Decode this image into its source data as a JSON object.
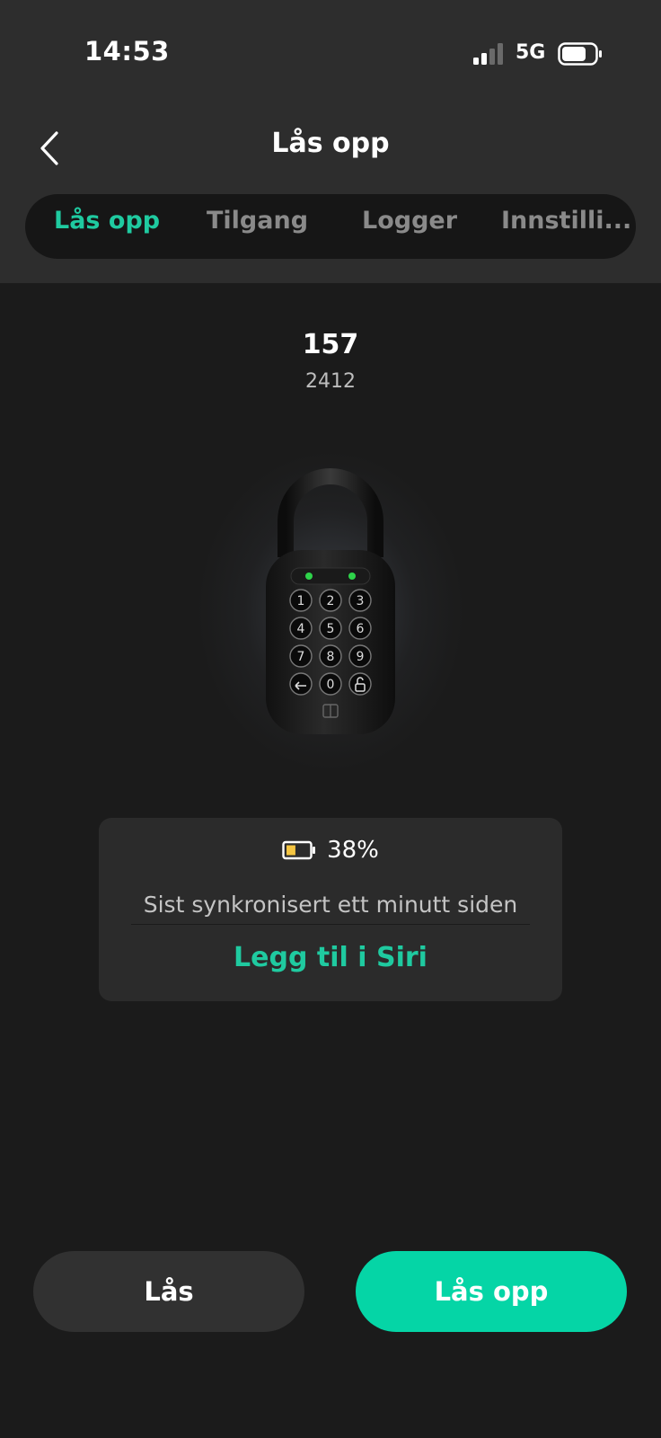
{
  "status_bar": {
    "time": "14:53",
    "network": "5G",
    "icons": [
      "signal-bars-icon",
      "battery-icon"
    ]
  },
  "nav": {
    "back_icon": "chevron-left-icon",
    "title": "Lås opp"
  },
  "tabs": [
    {
      "label": "Lås opp",
      "active": true
    },
    {
      "label": "Tilgang",
      "active": false
    },
    {
      "label": "Logger",
      "active": false
    },
    {
      "label": "Innstilli...",
      "active": false
    }
  ],
  "lock": {
    "name": "157",
    "code": "2412",
    "image_icon": "padlock-keypad-icon"
  },
  "info_card": {
    "battery_percent": "38%",
    "battery_level": 0.38,
    "battery_icon": "battery-low-icon",
    "sync_text": "Sist synkronisert ett minutt siden",
    "siri_link": "Legg til i Siri"
  },
  "actions": {
    "lock_label": "Lås",
    "unlock_label": "Lås opp"
  },
  "colors": {
    "accent": "#1fcaa0",
    "unlock_button": "#05d5a6",
    "background": "#1b1b1b",
    "header": "#2d2d2d",
    "battery_fill": "#f5c542"
  }
}
